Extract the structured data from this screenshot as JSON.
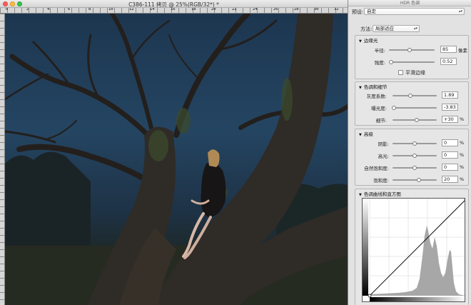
{
  "window": {
    "title": "C386-111 拷贝 @ 25%(RGB/32*) *",
    "ruler_marks": [
      "0",
      "2",
      "4",
      "6",
      "8",
      "10",
      "12",
      "14",
      "16",
      "18",
      "20",
      "22",
      "24",
      "26",
      "28",
      "30",
      "32"
    ]
  },
  "panel": {
    "title": "HDR 色调",
    "preset_label": "预设:",
    "preset_value": "自定",
    "method_label": "方法:",
    "method_value": "局部适应",
    "edge_glow": {
      "title": "边缘光",
      "radius_label": "半径:",
      "radius_value": "85",
      "radius_unit": "像素",
      "strength_label": "强度:",
      "strength_value": "0.52",
      "smooth_label": "平滑边缘"
    },
    "tone_detail": {
      "title": "色调和细节",
      "gamma_label": "灰度系数:",
      "gamma_value": "1.89",
      "exposure_label": "曝光度:",
      "exposure_value": "-3.83",
      "detail_label": "细节:",
      "detail_value": "+30",
      "detail_unit": "%"
    },
    "advanced": {
      "title": "高级",
      "shadow_label": "阴影:",
      "shadow_value": "0",
      "highlight_label": "高光:",
      "highlight_value": "0",
      "vibrance_label": "自然饱和度:",
      "vibrance_value": "0",
      "saturation_label": "饱和度:",
      "saturation_value": "20",
      "unit": "%"
    },
    "curve": {
      "title": "色调曲线和直方图"
    }
  },
  "sliders": {
    "radius": 0.45,
    "strength": 0.05,
    "gamma": 0.4,
    "exposure": 0.03,
    "detail": 0.55,
    "shadow": 0.5,
    "highlight": 0.5,
    "vibrance": 0.5,
    "saturation": 0.6
  },
  "colors": {
    "panel_bg": "#e2e2e2",
    "sky": "#244562",
    "tree": "#2f2b27"
  },
  "icons": {
    "close": "close-icon",
    "collapse": "triangle-down-icon",
    "dropdown": "updown-arrows-icon"
  }
}
